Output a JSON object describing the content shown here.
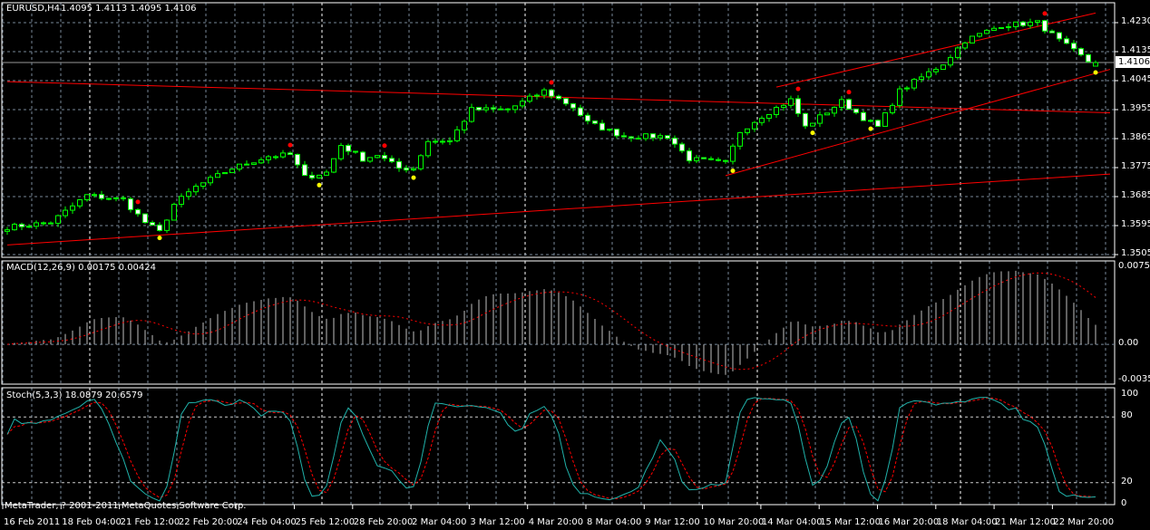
{
  "header": {
    "symbol": "EURUSD,H4",
    "ohlc": "1.4095 1.4113 1.4095 1.4106"
  },
  "macd_label": "MACD(12,26,9) 0.00175 0.00424",
  "stoch_label": "Stoch(5,3,3) 18.0879 20.6579",
  "copyright": "MetaTrader, ? 2001-2011 MetaQuotes Software Corp.",
  "bid_label": "1.4106",
  "colors": {
    "bull": "#00ff00",
    "bear_body": "#ffffff",
    "trendline": "#ff0000",
    "fractal_up": "#ff0000",
    "fractal_down": "#ffff00",
    "stoch_main": "#20b2aa",
    "stoch_signal": "#ff0000",
    "grid": "#778899"
  },
  "chart_data": {
    "type": "candlestick",
    "price_axis": [
      "1.4230",
      "1.4135",
      "1.4045",
      "1.3955",
      "1.3865",
      "1.3775",
      "1.3685",
      "1.3595",
      "1.3505"
    ],
    "macd_axis": [
      "0.00754",
      "0.00",
      "-0.00354"
    ],
    "stoch_axis": [
      "100",
      "80",
      "20",
      "0"
    ],
    "time_axis": [
      "16 Feb 2011",
      "18 Feb 04:00",
      "21 Feb 12:00",
      "22 Feb 20:00",
      "24 Feb 04:00",
      "25 Feb 12:00",
      "28 Feb 20:00",
      "2 Mar 04:00",
      "3 Mar 12:00",
      "4 Mar 20:00",
      "8 Mar 04:00",
      "9 Mar 12:00",
      "10 Mar 20:00",
      "14 Mar 04:00",
      "15 Mar 12:00",
      "16 Mar 20:00",
      "18 Mar 04:00",
      "21 Mar 12:00",
      "22 Mar 20:00"
    ],
    "close_path": [
      [
        0,
        1.3595
      ],
      [
        6,
        1.361
      ],
      [
        11,
        1.3694
      ],
      [
        16,
        1.368
      ],
      [
        19,
        1.361
      ],
      [
        21,
        1.358
      ],
      [
        23,
        1.3666
      ],
      [
        26,
        1.372
      ],
      [
        31,
        1.3778
      ],
      [
        36,
        1.3815
      ],
      [
        39,
        1.382
      ],
      [
        41,
        1.375
      ],
      [
        44,
        1.3765
      ],
      [
        46,
        1.385
      ],
      [
        49,
        1.3807
      ],
      [
        51,
        1.382
      ],
      [
        54,
        1.3778
      ],
      [
        56,
        1.3778
      ],
      [
        58,
        1.3863
      ],
      [
        61,
        1.3863
      ],
      [
        64,
        1.396
      ],
      [
        69,
        1.396
      ],
      [
        74,
        1.4018
      ],
      [
        78,
        1.3968
      ],
      [
        80,
        1.392
      ],
      [
        85,
        1.3877
      ],
      [
        91,
        1.3877
      ],
      [
        94,
        1.3807
      ],
      [
        99,
        1.3793
      ],
      [
        101,
        1.3892
      ],
      [
        104,
        1.394
      ],
      [
        108,
        1.399
      ],
      [
        110,
        1.3906
      ],
      [
        115,
        1.3985
      ],
      [
        118,
        1.3934
      ],
      [
        120,
        1.3906
      ],
      [
        123,
        1.4018
      ],
      [
        129,
        1.4103
      ],
      [
        132,
        1.4174
      ],
      [
        137,
        1.4222
      ],
      [
        142,
        1.423
      ],
      [
        145,
        1.4174
      ],
      [
        149,
        1.411
      ],
      [
        150,
        1.4106
      ]
    ],
    "trendlines": [
      {
        "from": [
          0,
          1.4047
        ],
        "to": [
          152,
          1.395
        ]
      },
      {
        "from": [
          0,
          1.354
        ],
        "to": [
          152,
          1.376
        ]
      },
      {
        "from": [
          99,
          1.3755
        ],
        "to": [
          152,
          1.4085
        ]
      },
      {
        "from": [
          106,
          1.403
        ],
        "to": [
          150,
          1.426
        ]
      }
    ],
    "fractals_up": [
      18,
      39,
      52,
      75,
      109,
      116,
      143
    ],
    "fractals_down": [
      21,
      43,
      56,
      100,
      111,
      119,
      150
    ],
    "macd": {
      "fast": 12,
      "slow": 26,
      "signal": 9,
      "range": [
        -0.00354,
        0.00754
      ]
    },
    "stoch": {
      "k": 5,
      "d": 3,
      "slowing": 3,
      "levels": [
        80,
        20
      ]
    }
  }
}
